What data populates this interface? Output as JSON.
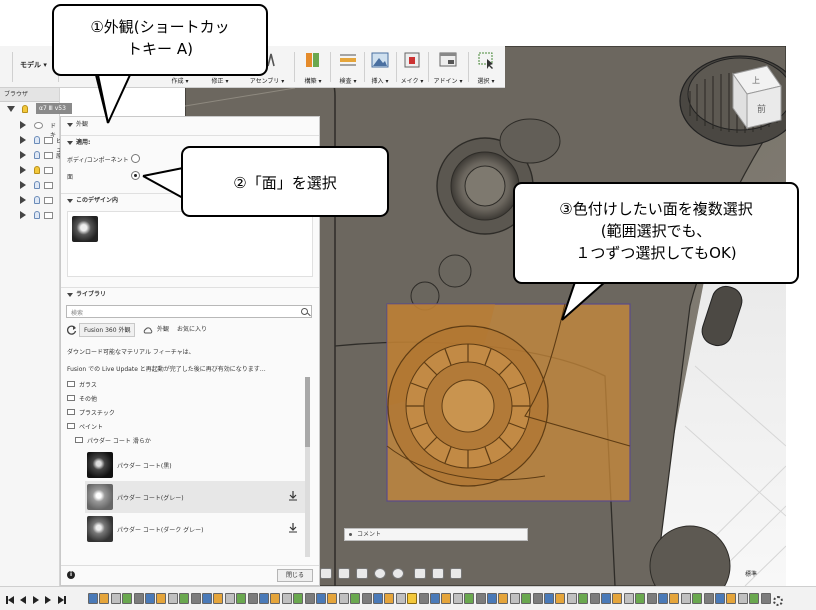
{
  "toolbar": {
    "model_menu": "モデル ▾",
    "groups": [
      {
        "label": "作成 ▾"
      },
      {
        "label": "修正 ▾"
      },
      {
        "label": "アセンブリ ▾"
      },
      {
        "label": "構築 ▾"
      },
      {
        "label": "検査 ▾"
      },
      {
        "label": "挿入 ▾"
      },
      {
        "label": "メイク ▾"
      },
      {
        "label": "アドイン ▾"
      },
      {
        "label": "選択 ▾"
      }
    ]
  },
  "browser": {
    "title": "ブラウザ",
    "root_label": "α7 Ⅲ v53",
    "items": [
      {
        "label": "ドキ"
      },
      {
        "label": "ビュ"
      },
      {
        "label": "原"
      },
      {
        "label": ""
      },
      {
        "label": ""
      },
      {
        "label": ""
      },
      {
        "label": ""
      }
    ]
  },
  "panel": {
    "title": "外観",
    "apply_section": "適用:",
    "option_body": "ボディ/コンポーネント",
    "option_face": "面",
    "in_design_section": "このデザイン内",
    "library_section": "ライブラリ",
    "search_placeholder": "検索",
    "tab_fusion": "Fusion 360 外観",
    "tab_appearance": "外観",
    "tab_favorites": "お気に入り",
    "notice_1": "ダウンロード可能なマテリアル フィーチャは、",
    "notice_2": "Fusion での Live Update と再起動が完了した後に再び有効になります…",
    "folders": [
      {
        "label": "ガラス"
      },
      {
        "label": "その他"
      },
      {
        "label": "プラスチック"
      },
      {
        "label": "ペイント"
      }
    ],
    "subfolder": "パウダー コート 滑らか",
    "materials": [
      {
        "label": "パウダー コート(黒)"
      },
      {
        "label": "パウダー コート(グレー)"
      },
      {
        "label": "パウダー コート(ダーク グレー)"
      }
    ],
    "close_button": "閉じる"
  },
  "comment_bar": {
    "label": "コメント"
  },
  "viewcube": {
    "top": "上",
    "front": "前"
  },
  "viewport_text": {
    "mode": "標準"
  },
  "callouts": {
    "c1_line1": "①外観(ショートカッ",
    "c1_line2": "トキー A)",
    "c2": "②「面」を選択",
    "c3_line1": "③色付けしたい面を複数選択",
    "c3_line2": "(範囲選択でも、",
    "c3_line3": "１つずつ選択してもOK)"
  },
  "colors": {
    "selection_fill": "#c98a3a",
    "selection_border": "#5a4a8a",
    "model_grey": "#6f6a62",
    "timeline_highlight": "#f3c83b"
  }
}
